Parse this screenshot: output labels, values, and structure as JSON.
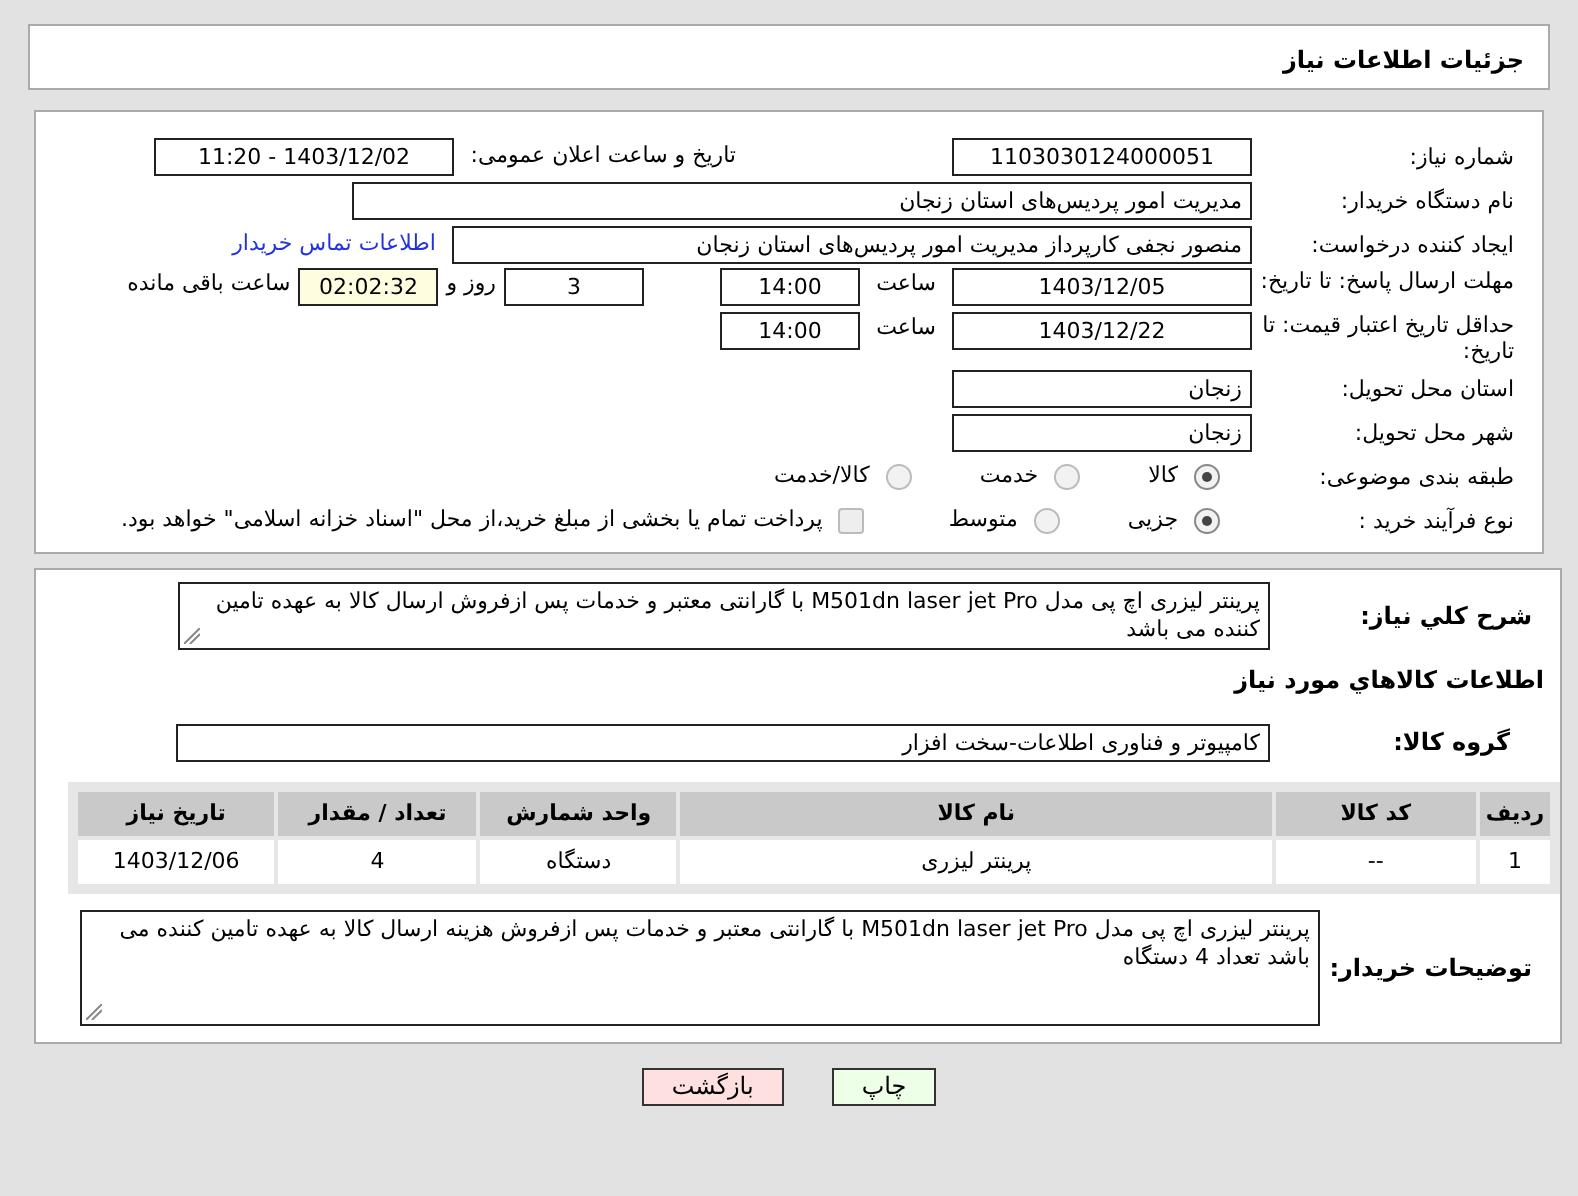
{
  "header": {
    "title": "جزئیات اطلاعات نیاز"
  },
  "need_number": {
    "label": "شماره نیاز:",
    "value": "1103030124000051"
  },
  "announce": {
    "label": "تاریخ و ساعت اعلان عمومی:",
    "value": "1403/12/02 - 11:20"
  },
  "buyer_org": {
    "label": "نام دستگاه خریدار:",
    "value": "مدیریت امور پردیس‌های استان زنجان"
  },
  "requester": {
    "label": "ایجاد کننده درخواست:",
    "value": "منصور نجفی کارپرداز  مدیریت امور پردیس‌های استان زنجان",
    "link": "اطلاعات تماس خریدار"
  },
  "reply_deadline": {
    "label": "مهلت ارسال پاسخ: تا تاریخ:",
    "date": "1403/12/05",
    "time_label": "ساعت",
    "time": "14:00",
    "days": "3",
    "days_label": "روز و",
    "remaining": "02:02:32",
    "remaining_label": "ساعت باقی مانده"
  },
  "price_validity": {
    "label": "حداقل تاریخ اعتبار قیمت: تا تاریخ:",
    "date": "1403/12/22",
    "time_label": "ساعت",
    "time": "14:00"
  },
  "delivery_province": {
    "label": "استان محل تحویل:",
    "value": "زنجان"
  },
  "delivery_city": {
    "label": "شهر محل تحویل:",
    "value": "زنجان"
  },
  "category": {
    "label": "طبقه بندی موضوعی:",
    "options": [
      {
        "label": "کالا",
        "selected": true
      },
      {
        "label": "خدمت",
        "selected": false
      },
      {
        "label": "کالا/خدمت",
        "selected": false
      }
    ]
  },
  "purchase_type": {
    "label": "نوع فرآیند خرید :",
    "options": [
      {
        "label": "جزیی",
        "selected": true
      },
      {
        "label": "متوسط",
        "selected": false
      }
    ],
    "payment": {
      "label": "پرداخت تمام یا بخشی از مبلغ خرید،از محل \"اسناد خزانه اسلامی\" خواهد بود.",
      "checked": false
    }
  },
  "description": {
    "label": "شرح کلي نياز:",
    "value": "پرینتر لیزری اچ پی مدل M501dn laser jet Pro با گارانتی  معتبر و خدمات پس ازفروش ارسال کالا به عهده تامین کننده می باشد"
  },
  "goods_title": "اطلاعات کالاهاي مورد نياز",
  "goods_group": {
    "label": "گروه کالا:",
    "value": "کامپیوتر و فناوری اطلاعات-سخت افزار"
  },
  "table": {
    "columns": [
      "ردیف",
      "کد کالا",
      "نام کالا",
      "واحد شمارش",
      "تعداد / مقدار",
      "تاریخ نیاز"
    ],
    "rows": [
      [
        "1",
        "--",
        "پرینتر لیزری",
        "دستگاه",
        "4",
        "1403/12/06"
      ]
    ]
  },
  "buyer_notes": {
    "label": "توضیحات خریدار:",
    "value": "پرینتر لیزری اچ پی مدل M501dn laser jet Pro با گارانتی  معتبر و خدمات پس ازفروش هزینه  ارسال کالا به عهده تامین کننده می باشد تعداد 4 دستگاه"
  },
  "buttons": [
    {
      "label": "چاپ",
      "kind": "print"
    },
    {
      "label": "بازگشت",
      "kind": "back"
    }
  ]
}
